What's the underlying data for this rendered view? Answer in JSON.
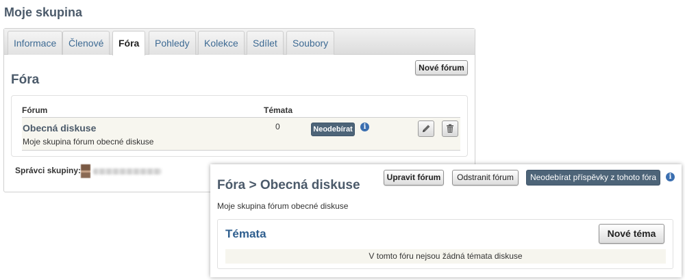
{
  "page": {
    "title": "Moje skupina"
  },
  "tabs": [
    {
      "label": "Informace",
      "active": false
    },
    {
      "label": "Členové",
      "active": false
    },
    {
      "label": "Fóra",
      "active": true
    },
    {
      "label": "Pohledy",
      "active": false
    },
    {
      "label": "Kolekce",
      "active": false
    },
    {
      "label": "Sdílet",
      "active": false
    },
    {
      "label": "Soubory",
      "active": false
    }
  ],
  "forums": {
    "title": "Fóra",
    "new_forum_label": "Nové fórum",
    "columns": {
      "forum": "Fórum",
      "topics": "Témata"
    },
    "rows": [
      {
        "name": "Obecná diskuse",
        "description": "Moje skupina fórum obecné diskuse",
        "topics": "0",
        "unsubscribe_label": "Neodebírat",
        "info_icon": "info-icon",
        "edit_icon": "pencil-icon",
        "delete_icon": "trash-icon"
      }
    ],
    "admins_label": "Správci skupiny:"
  },
  "forum_detail": {
    "breadcrumb": "Fóra > Obecná diskuse",
    "description": "Moje skupina fórum obecné diskuse",
    "edit_label": "Upravit fórum",
    "delete_label": "Odstranit fórum",
    "unsubscribe_label": "Neodebírat příspěvky z tohoto fóra",
    "topics_title": "Témata",
    "new_topic_label": "Nové téma",
    "empty_message": "V tomto fóru nejsou žádná témata diskuse"
  },
  "colors": {
    "heading": "#4b5a6a",
    "link": "#3d6a93",
    "dark_button": "#4d6478",
    "info_icon": "#3b6fb0",
    "row_highlight": "#f7f6ef"
  }
}
